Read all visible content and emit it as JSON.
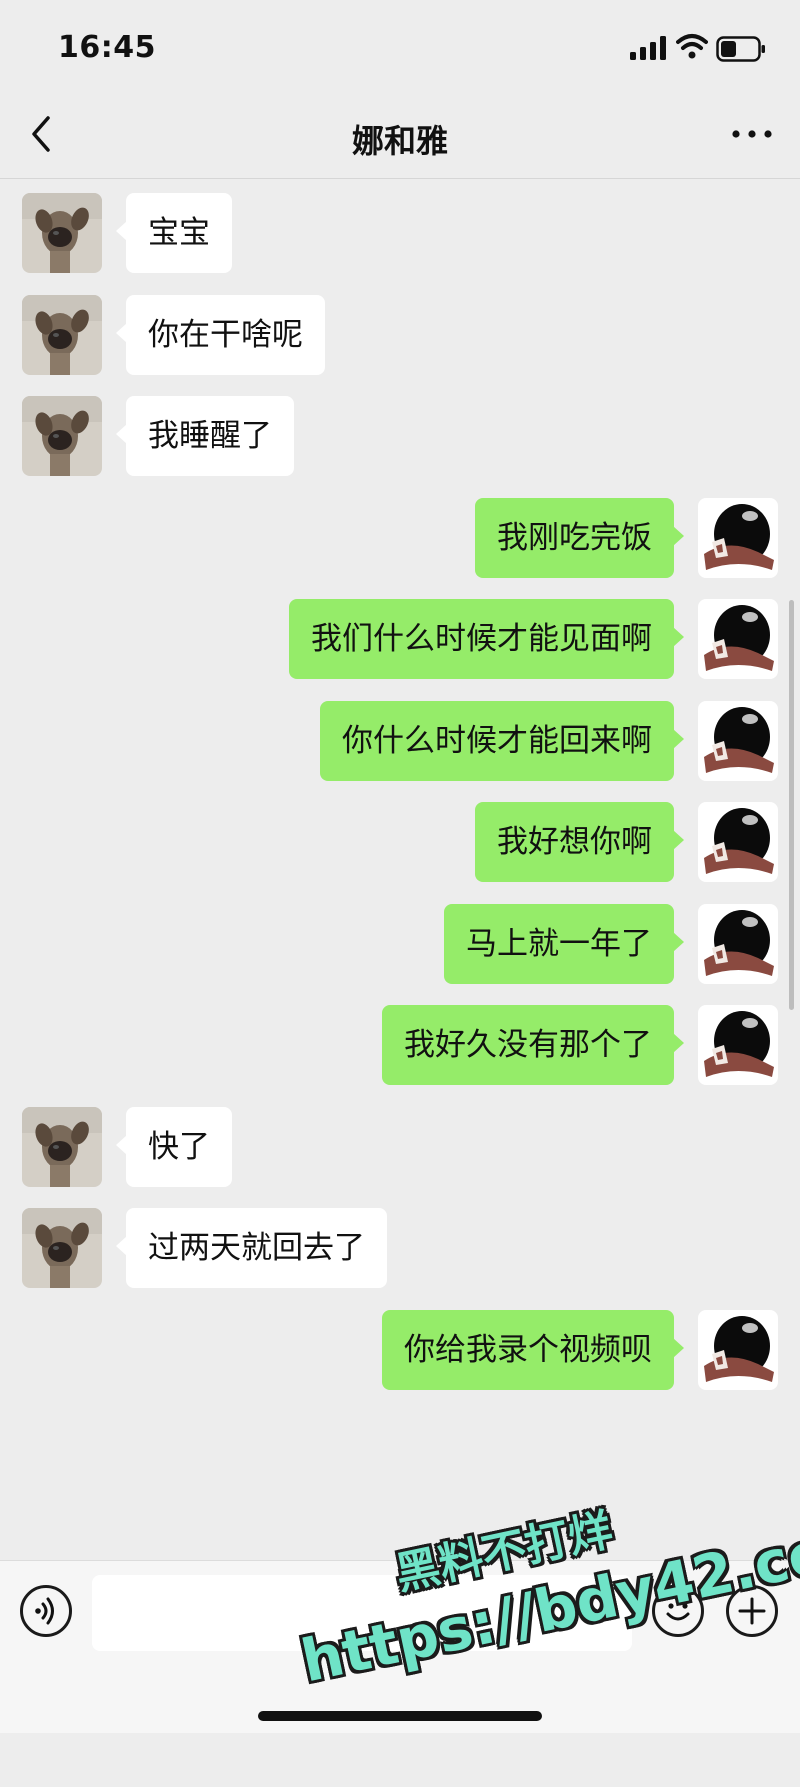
{
  "status_bar": {
    "time": "16:45"
  },
  "header": {
    "title": "娜和雅"
  },
  "messages": [
    {
      "side": "in",
      "text": "宝宝"
    },
    {
      "side": "in",
      "text": "你在干啥呢"
    },
    {
      "side": "in",
      "text": "我睡醒了"
    },
    {
      "side": "out",
      "text": "我刚吃完饭"
    },
    {
      "side": "out",
      "text": "我们什么时候才能见面啊"
    },
    {
      "side": "out",
      "text": "你什么时候才能回来啊"
    },
    {
      "side": "out",
      "text": "我好想你啊"
    },
    {
      "side": "out",
      "text": "马上就一年了"
    },
    {
      "side": "out",
      "text": "我好久没有那个了"
    },
    {
      "side": "in",
      "text": "快了"
    },
    {
      "side": "in",
      "text": "过两天就回去了"
    },
    {
      "side": "out",
      "text": "你给我录个视频呗"
    }
  ],
  "input_bar": {
    "value": ""
  },
  "watermark": {
    "line1": "黑料不打烊",
    "line2": "https://bdy42.co"
  },
  "colors": {
    "outgoing_bubble": "#95ec69",
    "incoming_bubble": "#ffffff",
    "background": "#ededed"
  },
  "icons": {
    "back": "chevron-left-icon",
    "more": "more-dots-icon",
    "voice": "voice-icon",
    "emoji": "emoji-icon",
    "plus": "plus-icon"
  }
}
